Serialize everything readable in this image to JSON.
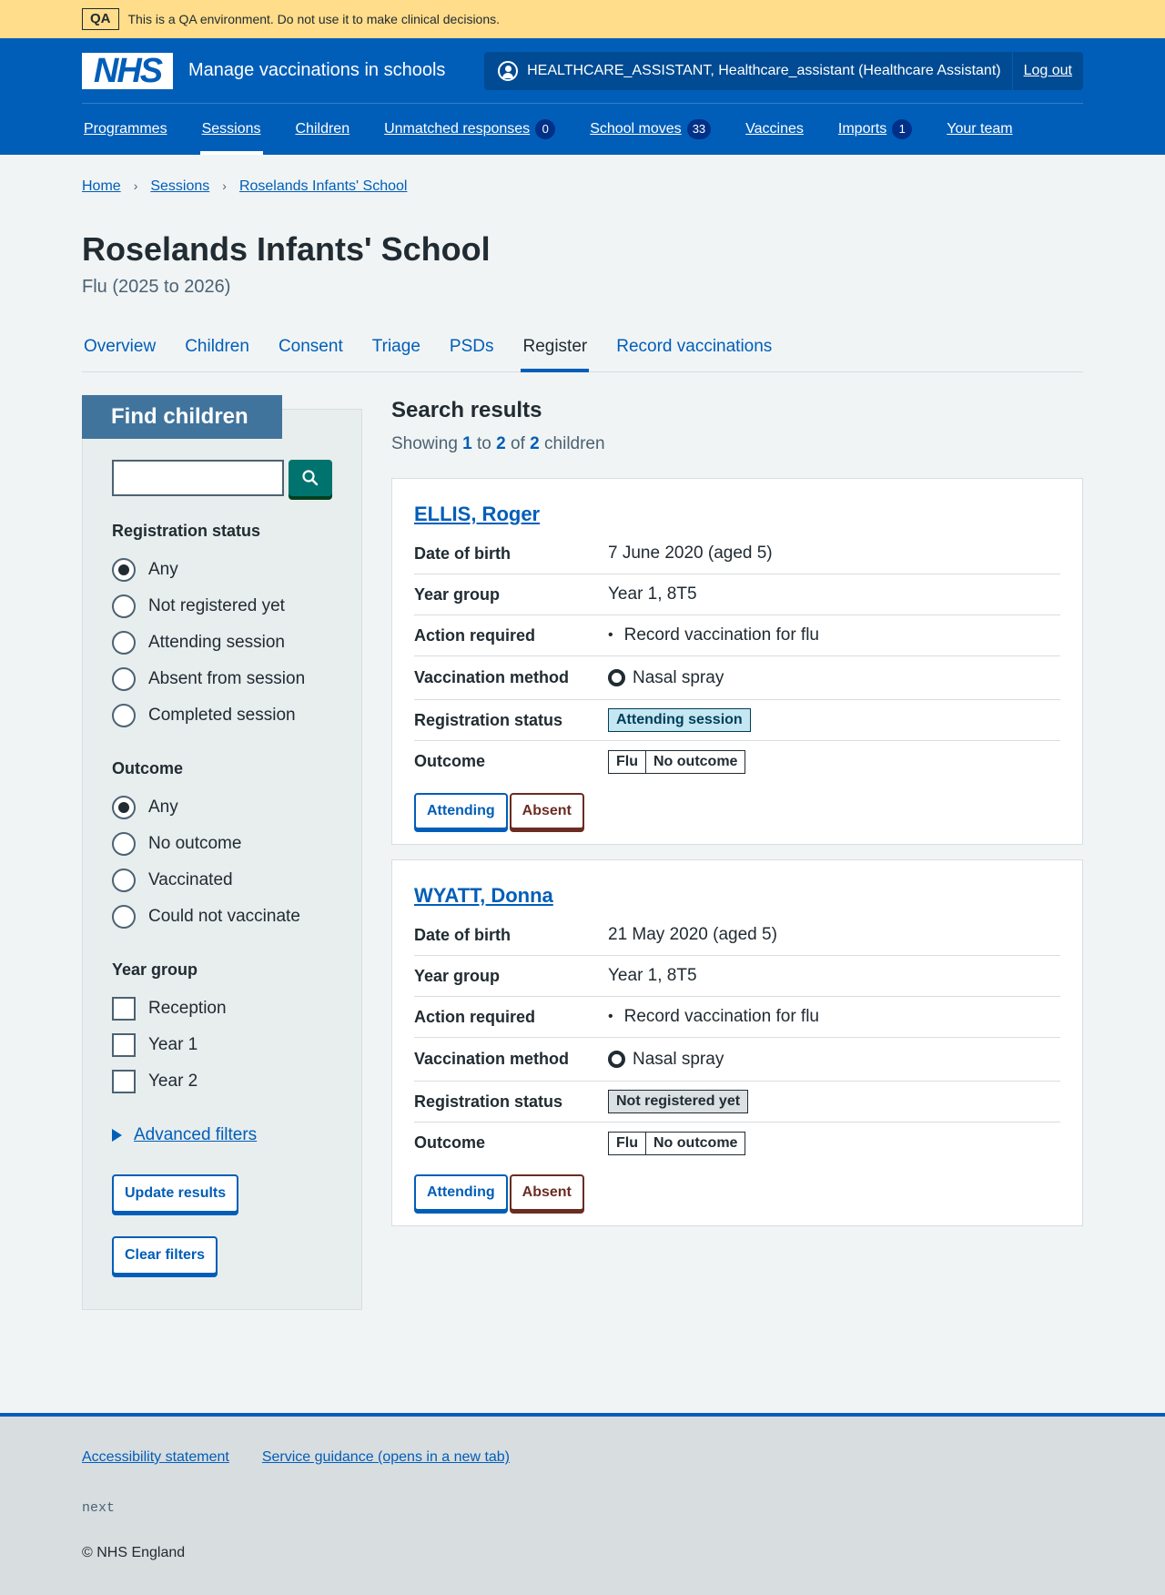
{
  "qa_banner": {
    "tag": "QA",
    "text": "This is a QA environment. Do not use it to make clinical decisions."
  },
  "header": {
    "logo": "NHS",
    "service_name": "Manage vaccinations in schools",
    "account_user": "HEALTHCARE_ASSISTANT, Healthcare_assistant (Healthcare Assistant)",
    "logout": "Log out"
  },
  "nav": [
    {
      "label": "Programmes",
      "badge": null
    },
    {
      "label": "Sessions",
      "badge": null,
      "active": true
    },
    {
      "label": "Children",
      "badge": null
    },
    {
      "label": "Unmatched responses",
      "badge": "0"
    },
    {
      "label": "School moves",
      "badge": "33"
    },
    {
      "label": "Vaccines",
      "badge": null
    },
    {
      "label": "Imports",
      "badge": "1"
    },
    {
      "label": "Your team",
      "badge": null
    }
  ],
  "breadcrumb": [
    "Home",
    "Sessions",
    "Roselands Infants' School"
  ],
  "page": {
    "title": "Roselands Infants' School",
    "caption": "Flu (2025 to 2026)"
  },
  "subnav": [
    "Overview",
    "Children",
    "Consent",
    "Triage",
    "PSDs",
    "Register",
    "Record vaccinations"
  ],
  "filters": {
    "heading": "Find children",
    "search_value": "",
    "registration_label": "Registration status",
    "registration_options": [
      "Any",
      "Not registered yet",
      "Attending session",
      "Absent from session",
      "Completed session"
    ],
    "outcome_label": "Outcome",
    "outcome_options": [
      "Any",
      "No outcome",
      "Vaccinated",
      "Could not vaccinate"
    ],
    "year_label": "Year group",
    "year_options": [
      "Reception",
      "Year 1",
      "Year 2"
    ],
    "advanced": "Advanced filters",
    "update": "Update results",
    "clear": "Clear filters"
  },
  "results": {
    "heading": "Search results",
    "count_prefix": "Showing",
    "from": "1",
    "to_word": "to",
    "to": "2",
    "of_word": "of",
    "total": "2",
    "suffix": "children",
    "labels": {
      "dob": "Date of birth",
      "year": "Year group",
      "action": "Action required",
      "method": "Vaccination method",
      "registration": "Registration status",
      "outcome": "Outcome"
    },
    "attending_btn": "Attending",
    "absent_btn": "Absent",
    "children": [
      {
        "name": "ELLIS, Roger",
        "dob": "7 June 2020 (aged 5)",
        "year": "Year 1, 8T5",
        "action": "Record vaccination for flu",
        "method": "Nasal spray",
        "registration": "Attending session",
        "outcome_programme": "Flu",
        "outcome": "No outcome"
      },
      {
        "name": "WYATT, Donna",
        "dob": "21 May 2020 (aged 5)",
        "year": "Year 1, 8T5",
        "action": "Record vaccination for flu",
        "method": "Nasal spray",
        "registration": "Not registered yet",
        "outcome_programme": "Flu",
        "outcome": "No outcome"
      }
    ]
  },
  "footer": {
    "links": [
      "Accessibility statement",
      "Service guidance (opens in a new tab)"
    ],
    "version": "next",
    "copyright": "© NHS England"
  },
  "colors": {
    "nhs_blue": "#005eb8",
    "qa_yellow": "#ffdd8a",
    "filter_heading": "#41749d"
  }
}
